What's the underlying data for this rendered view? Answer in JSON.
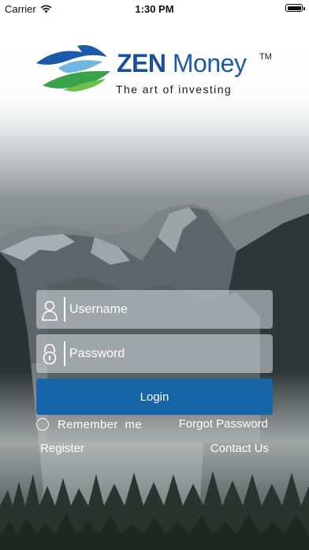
{
  "status_bar": {
    "carrier": "Carrier",
    "time": "1:30 PM",
    "icons": [
      "wifi-icon",
      "battery-icon"
    ]
  },
  "logo": {
    "brand_bold": "ZEN",
    "brand_regular": "Money",
    "trademark": "TM",
    "tagline": "The art of investing",
    "colors": {
      "brand_blue": "#1a4f9a",
      "mark_green": "#3aa24a",
      "mark_blue": "#1b5aa8"
    }
  },
  "form": {
    "username": {
      "placeholder": "Username",
      "value": "",
      "icon": "user-icon"
    },
    "password": {
      "placeholder": "Password",
      "value": "",
      "icon": "lock-icon"
    },
    "login_label": "Login",
    "remember_label": "Remember  me",
    "remember_checked": false,
    "forgot_label": "Forgot Password"
  },
  "footer_links": {
    "register": "Register",
    "contact": "Contact Us"
  },
  "colors": {
    "login_button": "#1565a8",
    "field_background": "rgba(220,225,230,0.55)",
    "text": "#ffffff"
  }
}
